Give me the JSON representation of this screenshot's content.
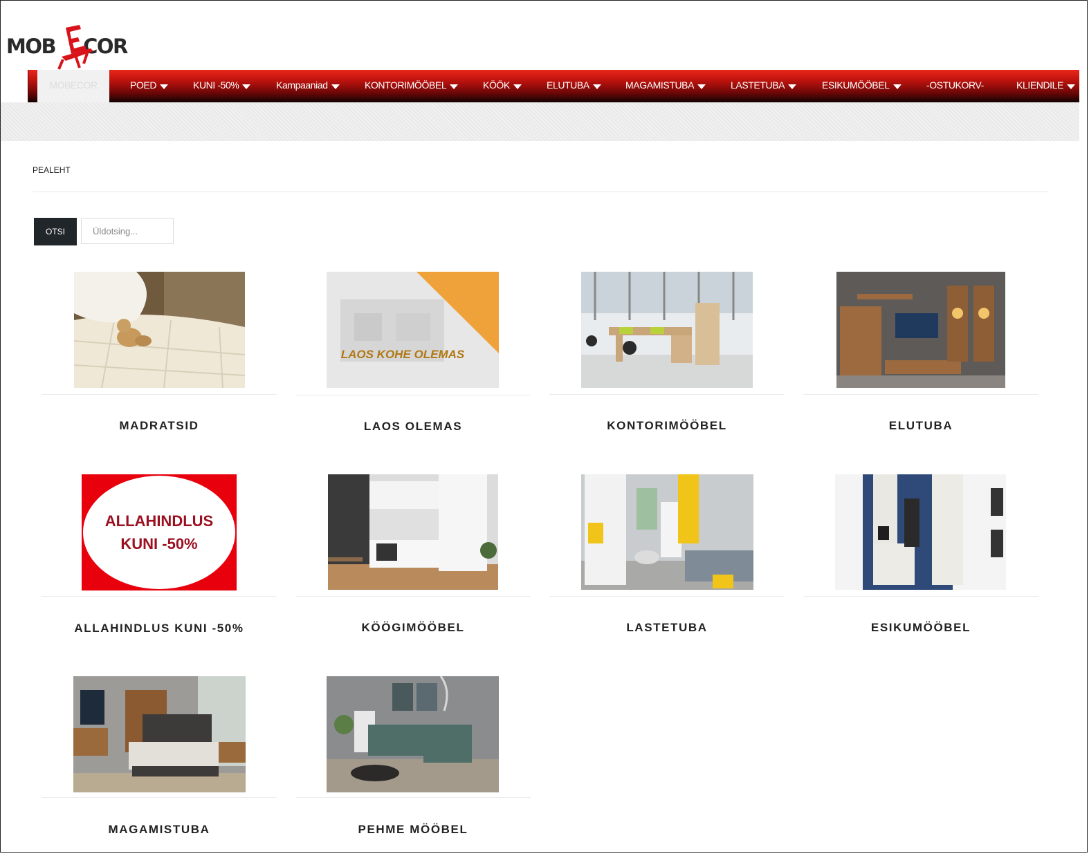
{
  "brand": {
    "logo_text": "MOBECOR"
  },
  "nav": {
    "items": [
      {
        "label": "MOBECOR",
        "dropdown": false,
        "active": true
      },
      {
        "label": "POED",
        "dropdown": true
      },
      {
        "label": "KUNI -50%",
        "dropdown": true
      },
      {
        "label": "Kampaaniad",
        "dropdown": true
      },
      {
        "label": "KONTORIMÖÖBEL",
        "dropdown": true
      },
      {
        "label": "KÖÖK",
        "dropdown": true
      },
      {
        "label": "ELUTUBA",
        "dropdown": true
      },
      {
        "label": "MAGAMISTUBA",
        "dropdown": true
      },
      {
        "label": "LASTETUBA",
        "dropdown": true
      },
      {
        "label": "ESIKUMÖÖBEL",
        "dropdown": true
      },
      {
        "label": "-OSTUKORV-",
        "dropdown": false
      },
      {
        "label": "KLIENDILE",
        "dropdown": true
      }
    ]
  },
  "breadcrumb": "PEALEHT",
  "search": {
    "button_label": "OTSI",
    "placeholder": "Üldotsing..."
  },
  "categories": [
    {
      "title": "MADRATSID",
      "image": "mattress-photo"
    },
    {
      "title": "LAOS OLEMAS",
      "image": "in-stock-banner",
      "image_text": "LAOS KOHE OLEMAS"
    },
    {
      "title": "KONTORIMÖÖBEL",
      "image": "office-photo"
    },
    {
      "title": "ELUTUBA",
      "image": "living-room-photo"
    },
    {
      "title": "ALLAHINDLUS KUNI -50%",
      "image": "sale-banner",
      "image_text_line1": "ALLAHINDLUS",
      "image_text_line2": "KUNI -50%"
    },
    {
      "title": "KÖÖGIMÖÖBEL",
      "image": "kitchen-photo"
    },
    {
      "title": "LASTETUBA",
      "image": "kids-room-photo"
    },
    {
      "title": "ESIKUMÖÖBEL",
      "image": "hallway-photo"
    },
    {
      "title": "MAGAMISTUBA",
      "image": "bedroom-photo"
    },
    {
      "title": "PEHME MÖÖBEL",
      "image": "sofa-photo"
    }
  ],
  "colors": {
    "nav_top": "#e8261c",
    "nav_bottom": "#120202",
    "search_button": "#21262b",
    "sale_red": "#e8000d",
    "sale_text": "#9b1020",
    "banner_orange": "#f0a23a",
    "banner_text": "#b07813"
  }
}
